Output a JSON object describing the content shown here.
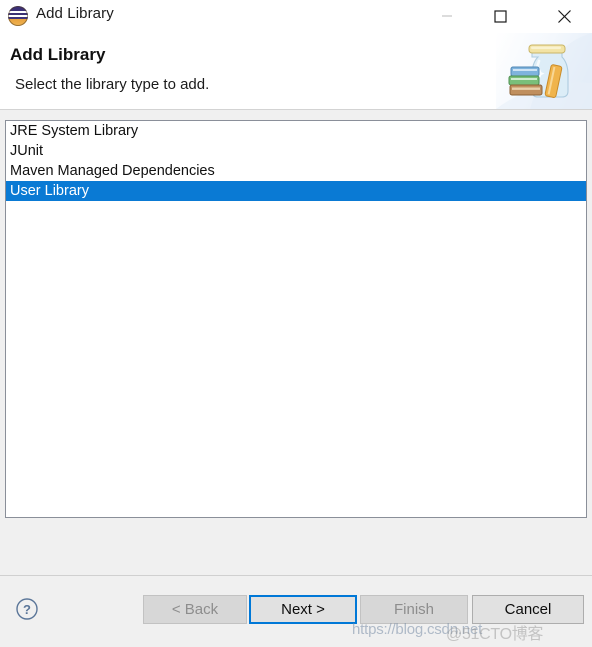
{
  "window": {
    "title": "Add Library",
    "icon": "eclipse-icon",
    "controls": {
      "minimize_label": "Minimize",
      "minimize_enabled": false,
      "maximize_label": "Maximize",
      "close_label": "Close"
    }
  },
  "header": {
    "title": "Add Library",
    "subtitle": "Select the library type to add.",
    "banner_icon": "jar-with-books-icon"
  },
  "list": {
    "name": "library-type-list",
    "items": [
      {
        "label": "JRE System Library",
        "selected": false
      },
      {
        "label": "JUnit",
        "selected": false
      },
      {
        "label": "Maven Managed Dependencies",
        "selected": false
      },
      {
        "label": "User Library",
        "selected": true
      }
    ],
    "selected_value": "User Library"
  },
  "footer": {
    "help_icon": "help-question-icon",
    "buttons": {
      "back": {
        "label": "< Back",
        "enabled": false,
        "focused": false
      },
      "next": {
        "label": "Next >",
        "enabled": true,
        "focused": true
      },
      "finish": {
        "label": "Finish",
        "enabled": false,
        "focused": false
      },
      "cancel": {
        "label": "Cancel",
        "enabled": true,
        "focused": false
      }
    }
  },
  "watermark": {
    "url": "https://blog.csdn.net",
    "tag": "@51CTO博客"
  },
  "colors": {
    "selection_blue": "#0a7ad4",
    "focus_blue": "#0078d7",
    "dialog_bg": "#f0f0f0",
    "content_bg": "#ffffff",
    "list_border": "#8a8f99"
  }
}
